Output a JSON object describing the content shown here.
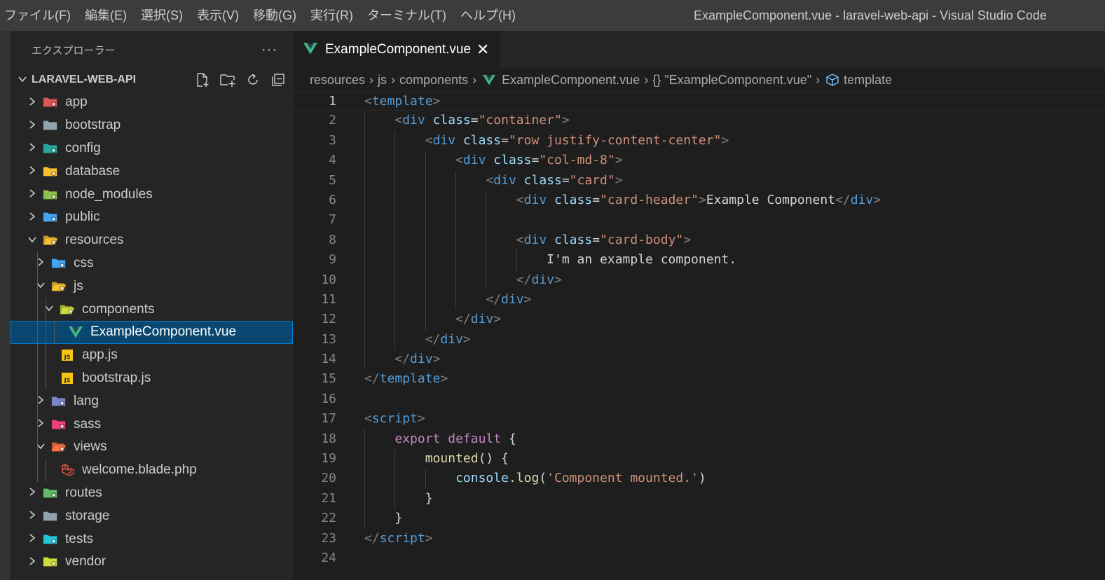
{
  "titlebar": {
    "menu": [
      "ファイル(F)",
      "編集(E)",
      "選択(S)",
      "表示(V)",
      "移動(G)",
      "実行(R)",
      "ターミナル(T)",
      "ヘルプ(H)"
    ],
    "window_title": "ExampleComponent.vue - laravel-web-api - Visual Studio Code"
  },
  "sidebar": {
    "title": "エクスプローラー",
    "more": "···",
    "project": "LARAVEL-WEB-API",
    "items": [
      {
        "label": "app",
        "icon": "folder-app-icon",
        "color": "#e05555"
      },
      {
        "label": "bootstrap",
        "icon": "folder-icon",
        "color": "#90a4ae"
      },
      {
        "label": "config",
        "icon": "folder-config-icon",
        "color": "#26a69a"
      },
      {
        "label": "database",
        "icon": "folder-database-icon",
        "color": "#fbc02d"
      },
      {
        "label": "node_modules",
        "icon": "folder-node-icon",
        "color": "#8bc34a"
      },
      {
        "label": "public",
        "icon": "folder-public-icon",
        "color": "#42a5f5"
      },
      {
        "label": "resources",
        "icon": "folder-resources-open-icon",
        "color": "#fbc02d"
      },
      {
        "label": "css",
        "icon": "folder-css-icon",
        "color": "#42a5f5"
      },
      {
        "label": "js",
        "icon": "folder-js-open-icon",
        "color": "#fbc02d"
      },
      {
        "label": "components",
        "icon": "folder-components-open-icon",
        "color": "#cddc39"
      },
      {
        "label": "ExampleComponent.vue",
        "icon": "vue-file-icon",
        "color": "#41b883"
      },
      {
        "label": "app.js",
        "icon": "js-file-icon",
        "color": "#f5c518"
      },
      {
        "label": "bootstrap.js",
        "icon": "js-file-icon",
        "color": "#f5c518"
      },
      {
        "label": "lang",
        "icon": "folder-lang-icon",
        "color": "#7986cb"
      },
      {
        "label": "sass",
        "icon": "folder-sass-icon",
        "color": "#ec407a"
      },
      {
        "label": "views",
        "icon": "folder-views-open-icon",
        "color": "#ff7043"
      },
      {
        "label": "welcome.blade.php",
        "icon": "laravel-blade-icon",
        "color": "#f05340"
      },
      {
        "label": "routes",
        "icon": "folder-routes-icon",
        "color": "#66bb6a"
      },
      {
        "label": "storage",
        "icon": "folder-icon",
        "color": "#90a4ae"
      },
      {
        "label": "tests",
        "icon": "folder-tests-icon",
        "color": "#26c6da"
      },
      {
        "label": "vendor",
        "icon": "folder-vendor-icon",
        "color": "#cddc39"
      }
    ]
  },
  "editor": {
    "tab_label": "ExampleComponent.vue",
    "tab_close": "✕",
    "breadcrumbs": {
      "resources": "resources",
      "js": "js",
      "components": "components",
      "file": "ExampleComponent.vue",
      "object": "{} \"ExampleComponent.vue\"",
      "symbol": "template"
    },
    "line_numbers": [
      "1",
      "2",
      "3",
      "4",
      "5",
      "6",
      "7",
      "8",
      "9",
      "10",
      "11",
      "12",
      "13",
      "14",
      "15",
      "16",
      "17",
      "18",
      "19",
      "20",
      "21",
      "22",
      "23",
      "24"
    ],
    "code": {
      "lt": "<",
      "gt": ">",
      "lt_slash": "</",
      "tag_template": "template",
      "tag_div": "div",
      "tag_script": "script",
      "attr_class": "class",
      "eq": "=",
      "str_container": "\"container\"",
      "str_row": "\"row justify-content-center\"",
      "str_col": "\"col-md-8\"",
      "str_card": "\"card\"",
      "str_card_header": "\"card-header\"",
      "str_card_body": "\"card-body\"",
      "text_example": "Example Component",
      "text_body": "I'm an example component.",
      "kw_export": "export",
      "kw_default": "default",
      "brace_open": "{",
      "brace_close": "}",
      "fn_mounted": "mounted",
      "parens_brace": "() {",
      "var_console": "console",
      "dot": ".",
      "fn_log": "log",
      "paren_open": "(",
      "paren_close": ")",
      "str_log": "'Component mounted.'"
    }
  }
}
